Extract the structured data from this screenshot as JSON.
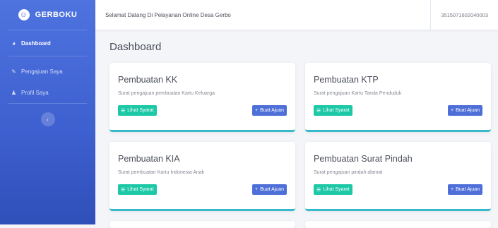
{
  "sidebar": {
    "brand": "GERBOKU",
    "items": [
      {
        "label": "Dashboard",
        "icon": "dashboard-icon"
      },
      {
        "label": "Pengajuan Saya",
        "icon": "edit-icon"
      },
      {
        "label": "Profil Saya",
        "icon": "user-icon"
      }
    ],
    "toggle": "‹"
  },
  "topbar": {
    "title": "Selamat Datang Di Pelayanan Online Desa Gerbo",
    "user_id": "3515071602040003"
  },
  "page": {
    "title": "Dashboard"
  },
  "cards": [
    {
      "title": "Pembuatan KK",
      "desc": "Surat pengajuan pembuatan Kartu Keluarga",
      "syarat": "Lihat Syarat",
      "ajuan": "Buat Ajuan"
    },
    {
      "title": "Pembuatan KTP",
      "desc": "Surat pengajuan Kartu Tanda Penduduk",
      "syarat": "Lihat Syarat",
      "ajuan": "Buat Ajuan"
    },
    {
      "title": "Pembuatan KIA",
      "desc": "Surat pembuatan Kartu Indonesia Anak",
      "syarat": "Lihat Syarat",
      "ajuan": "Buat Ajuan"
    },
    {
      "title": "Pembuatan Surat Pindah",
      "desc": "Surat pengajuan pindah alamat",
      "syarat": "Lihat Syarat",
      "ajuan": "Buat Ajuan"
    }
  ],
  "colors": {
    "sidebar": "#4e73df",
    "syarat_button": "#1cc8a6",
    "ajuan_button": "#4e6fd8",
    "card_accent": "#36b9cc"
  }
}
